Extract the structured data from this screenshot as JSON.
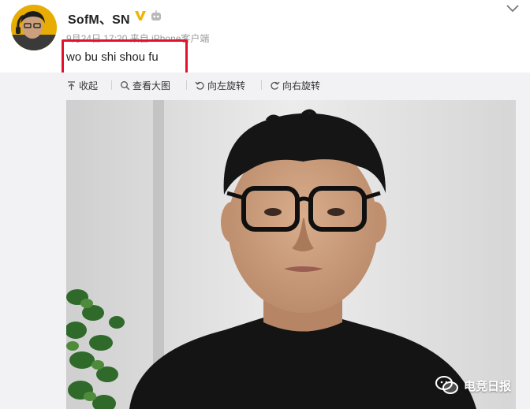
{
  "post": {
    "username": "SofM、SN",
    "meta": "9月24日 17:20 来自 iPhone客户端",
    "text": "wo bu shi shou fu"
  },
  "toolbar": {
    "collapse": "收起",
    "view_large": "查看大图",
    "rotate_left": "向左旋转",
    "rotate_right": "向右旋转"
  },
  "watermark": "电竞日报",
  "colors": {
    "highlight": "#e5102c",
    "verified": "#f0b400",
    "toolbar_bg": "#f2f2f5"
  },
  "icons": [
    "verified-v-icon",
    "robot-icon",
    "chevron-down-icon",
    "collapse-icon",
    "search-icon",
    "rotate-left-icon",
    "rotate-right-icon",
    "wechat-icon"
  ]
}
